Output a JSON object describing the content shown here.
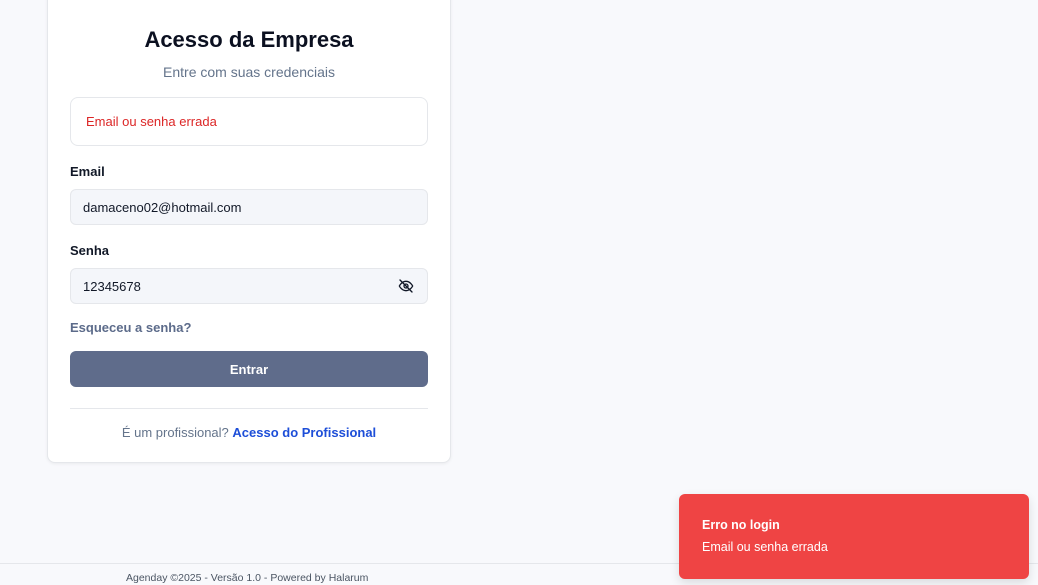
{
  "login": {
    "title": "Acesso da Empresa",
    "subtitle": "Entre com suas credenciais",
    "error_message": "Email ou senha errada",
    "email_label": "Email",
    "email_value": "damaceno02@hotmail.com",
    "password_label": "Senha",
    "password_value": "12345678",
    "password_toggle_icon": "eye-off-icon",
    "forgot_link": "Esqueceu a senha?",
    "submit_label": "Entrar",
    "professional_prompt": "É um profissional?",
    "professional_link": "Acesso do Profissional"
  },
  "footer": {
    "text": "Agenday ©2025 - Versão 1.0 - Powered by Halarum"
  },
  "toast": {
    "title": "Erro no login",
    "message": "Email ou senha errada",
    "color": "#ef4444"
  },
  "colors": {
    "background": "#f8f9fc",
    "primary_button": "#5f6c8b",
    "link": "#1d4ed8",
    "error_text": "#dc2626"
  }
}
